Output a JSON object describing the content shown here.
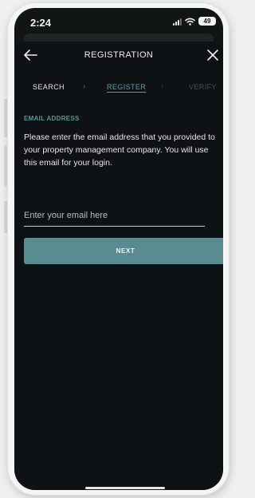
{
  "status_bar": {
    "time": "2:24",
    "battery": "49"
  },
  "header": {
    "title": "REGISTRATION",
    "back_icon": "arrow-left-icon",
    "close_icon": "close-icon"
  },
  "steps": [
    {
      "label": "SEARCH",
      "state": "completed"
    },
    {
      "label": "REGISTER",
      "state": "active"
    },
    {
      "label": "VERIFY",
      "state": "upcoming"
    }
  ],
  "form": {
    "section_label": "EMAIL ADDRESS",
    "instructions": "Please enter the email address that you provided to your property management company. You will use this email for your login.",
    "email_value": "",
    "email_placeholder": "Enter your email here",
    "next_label": "NEXT"
  },
  "colors": {
    "accent": "#5a8b90",
    "accent_text": "#4f9aa0",
    "background": "#0e1214"
  }
}
